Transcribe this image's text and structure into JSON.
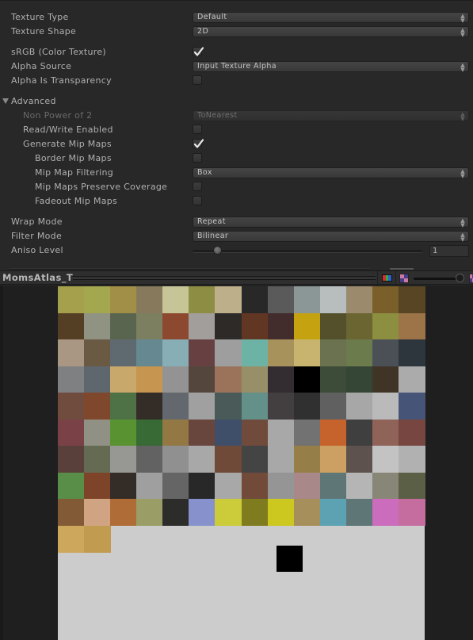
{
  "inspector": {
    "texture_type": {
      "label": "Texture Type",
      "value": "Default"
    },
    "texture_shape": {
      "label": "Texture Shape",
      "value": "2D"
    },
    "srgb": {
      "label": "sRGB (Color Texture)",
      "checked": true
    },
    "alpha_source": {
      "label": "Alpha Source",
      "value": "Input Texture Alpha"
    },
    "alpha_is_transparency": {
      "label": "Alpha Is Transparency",
      "checked": false
    },
    "advanced": {
      "label": "Advanced",
      "expanded": true,
      "non_power_of_2": {
        "label": "Non Power of 2",
        "value": "ToNearest",
        "disabled": true
      },
      "read_write_enabled": {
        "label": "Read/Write Enabled",
        "checked": false
      },
      "generate_mip_maps": {
        "label": "Generate Mip Maps",
        "checked": true
      },
      "border_mip_maps": {
        "label": "Border Mip Maps",
        "checked": false
      },
      "mip_map_filtering": {
        "label": "Mip Map Filtering",
        "value": "Box"
      },
      "mip_maps_preserve_coverage": {
        "label": "Mip Maps Preserve Coverage",
        "checked": false
      },
      "fadeout_mip_maps": {
        "label": "Fadeout Mip Maps",
        "checked": false
      }
    },
    "wrap_mode": {
      "label": "Wrap Mode",
      "value": "Repeat"
    },
    "filter_mode": {
      "label": "Filter Mode",
      "value": "Bilinear"
    },
    "aniso_level": {
      "label": "Aniso Level",
      "value": "1",
      "min": 0,
      "max": 16
    }
  },
  "preview": {
    "title": "MomsAtlas_T",
    "channel_icon": "rgb-channel-icon",
    "alpha_icon": "alpha-checker-icon",
    "mip_level": 0,
    "texture": {
      "background": "#cccccc",
      "columns": 14,
      "rows": [
        [
          "#a5a04b",
          "#a3a84f",
          "#a18f48",
          "#877a5c",
          "#c5c598",
          "#8d8d43",
          "#bdaf89",
          "#282828",
          "#5a5a5a",
          "#8b9696",
          "#b8bebe",
          "#9b8a6c",
          "#7a5f2a",
          "#574523"
        ],
        [
          "#553f24",
          "#909282",
          "#5a6550",
          "#7c7f60",
          "#8d4930",
          "#a29e9b",
          "#2e2a28",
          "#613724",
          "#422c2c",
          "#c5a210",
          "#55502c",
          "#6b6532",
          "#8c8f40",
          "#9c7447"
        ],
        [
          "#a99683",
          "#6a5943",
          "#5f6a70",
          "#668890",
          "#87aeb5",
          "#674142",
          "#9e9e9e",
          "#6db3a5",
          "#a8925c",
          "#c8b46f",
          "#6a7250",
          "#6b7b4c",
          "#4b5057",
          "#2c363c"
        ],
        [
          "#7f8082",
          "#5e676d",
          "#c9a86c",
          "#c69550",
          "#949393",
          "#54463c",
          "#9b735b",
          "#978f68",
          "#332d31",
          "#000000",
          "#3c4c38",
          "#354536",
          "#403426",
          "#ababab"
        ],
        [
          "#6f4c3e",
          "#7f472c",
          "#4e7145",
          "#332c27",
          "#62686d",
          "#a0a0a0",
          "#495a58",
          "#64908a",
          "#433e40",
          "#303030",
          "#606060",
          "#a7a7a7",
          "#bababa",
          "#465577"
        ],
        [
          "#7a4247",
          "#909085",
          "#589231",
          "#376a34",
          "#937843",
          "#68463e",
          "#3f4f69",
          "#704a3a",
          "#a8a8a8",
          "#727272",
          "#c6632c",
          "#3f3f3f",
          "#8f6358",
          "#774641"
        ],
        [
          "#5a403a",
          "#656b52",
          "#979893",
          "#626262",
          "#909090",
          "#a8a8a8",
          "#704a38",
          "#444444",
          "#a8a8a8",
          "#967e48",
          "#cba062",
          "#5e524e",
          "#c3c3c3",
          "#b1b1b1"
        ],
        [
          "#588e48",
          "#7e4429",
          "#342c26",
          "#9f9f9f",
          "#656565",
          "#282828",
          "#a8a8a8",
          "#714a3a",
          "#959595",
          "#a9888a",
          "#5e7676",
          "#b5b5b5",
          "#888676",
          "#5a5f45"
        ],
        [
          "#825a36",
          "#d0a482",
          "#b06c36",
          "#9a9e66",
          "#2c2c2a",
          "#8792cc",
          "#cccc3a",
          "#7f7c20",
          "#ccc820",
          "#a78f5c",
          "#5ca2b2",
          "#5e7676",
          "#cb6dbc",
          "#c46d9e"
        ],
        [
          "#cca75c",
          "#c19c50"
        ]
      ],
      "extra_marks": [
        {
          "color": "#000000",
          "col": 8.5,
          "row": 9.75,
          "cols": 1,
          "rows": 1
        }
      ]
    }
  }
}
